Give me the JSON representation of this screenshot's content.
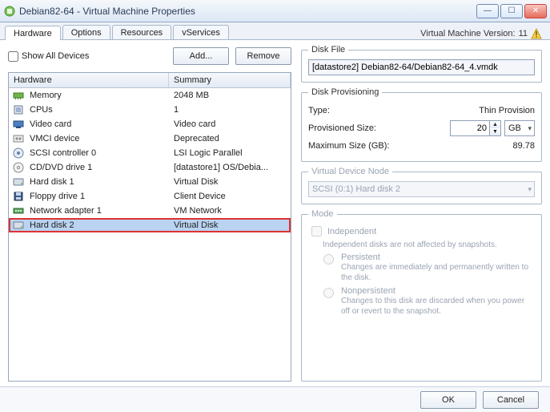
{
  "window": {
    "title": "Debian82-64 - Virtual Machine Properties"
  },
  "tabs": [
    "Hardware",
    "Options",
    "Resources",
    "vServices"
  ],
  "vm_version_label": "Virtual Machine Version:",
  "vm_version_value": "11",
  "show_all_devices_label": "Show All Devices",
  "buttons": {
    "add": "Add...",
    "remove": "Remove",
    "ok": "OK",
    "cancel": "Cancel"
  },
  "columns": {
    "hw": "Hardware",
    "sm": "Summary"
  },
  "devices": [
    {
      "icon": "memory",
      "name": "Memory",
      "summary": "2048 MB"
    },
    {
      "icon": "cpu",
      "name": "CPUs",
      "summary": "1"
    },
    {
      "icon": "video",
      "name": "Video card",
      "summary": "Video card"
    },
    {
      "icon": "vmci",
      "name": "VMCI device",
      "summary": "Deprecated"
    },
    {
      "icon": "scsi",
      "name": "SCSI controller 0",
      "summary": "LSI Logic Parallel"
    },
    {
      "icon": "cd",
      "name": "CD/DVD drive 1",
      "summary": "[datastore1] OS/Debia..."
    },
    {
      "icon": "hdd",
      "name": "Hard disk 1",
      "summary": "Virtual Disk"
    },
    {
      "icon": "floppy",
      "name": "Floppy drive 1",
      "summary": "Client Device"
    },
    {
      "icon": "nic",
      "name": "Network adapter 1",
      "summary": "VM Network"
    },
    {
      "icon": "hdd",
      "name": "Hard disk 2",
      "summary": "Virtual Disk"
    }
  ],
  "selected_index": 9,
  "disk_file": {
    "legend": "Disk File",
    "value": "[datastore2] Debian82-64/Debian82-64_4.vmdk"
  },
  "provisioning": {
    "legend": "Disk Provisioning",
    "type_label": "Type:",
    "type_value": "Thin Provision",
    "prov_size_label": "Provisioned Size:",
    "prov_size_value": "20",
    "prov_size_unit": "GB",
    "max_size_label": "Maximum Size (GB):",
    "max_size_value": "89.78"
  },
  "vdn": {
    "legend": "Virtual Device Node",
    "value": "SCSI (0:1) Hard disk 2"
  },
  "mode": {
    "legend": "Mode",
    "independent_label": "Independent",
    "independent_sub": "Independent disks are not affected by snapshots.",
    "persistent_label": "Persistent",
    "persistent_sub": "Changes are immediately and permanently written to the disk.",
    "nonpersistent_label": "Nonpersistent",
    "nonpersistent_sub": "Changes to this disk are discarded when you power off or revert to the snapshot."
  }
}
